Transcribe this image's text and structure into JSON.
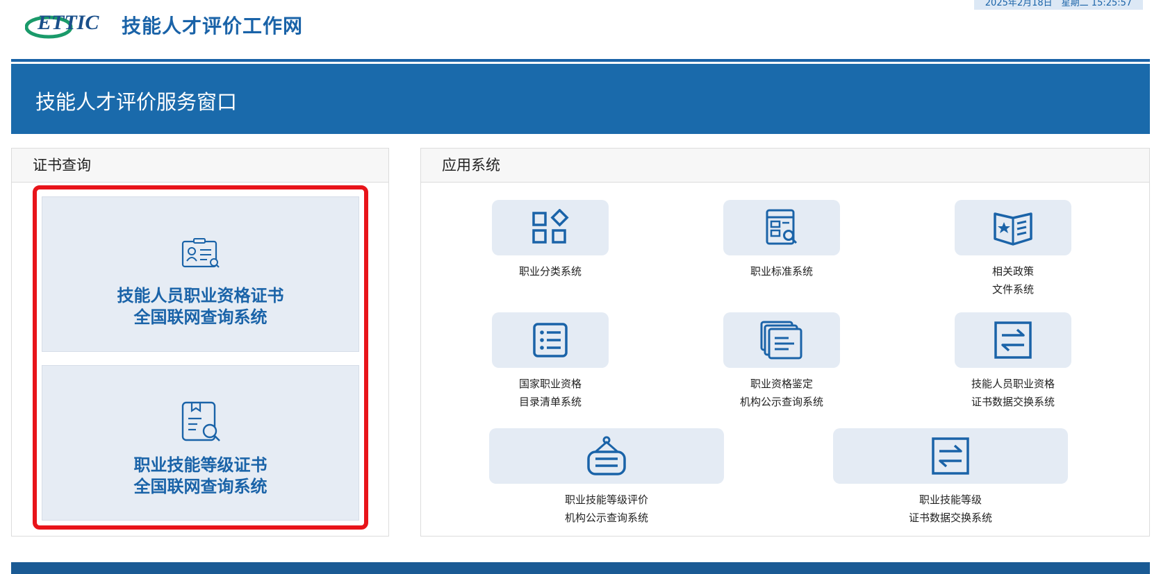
{
  "header": {
    "logo_text": "ETTIC",
    "site_title": "技能人才评价工作网",
    "datetime": "2025年2月18日　星期二 15:25:57"
  },
  "banner": {
    "title": "技能人才评价服务窗口"
  },
  "certificate_query": {
    "title": "证书查询",
    "cards": [
      {
        "line1": "技能人员职业资格证书",
        "line2": "全国联网查询系统",
        "icon": "id-card-search-icon"
      },
      {
        "line1": "职业技能等级证书",
        "line2": "全国联网查询系统",
        "icon": "document-search-icon"
      }
    ]
  },
  "applications": {
    "title": "应用系统",
    "items": [
      {
        "line1": "职业分类系统",
        "line2": "",
        "icon": "category-grid-icon"
      },
      {
        "line1": "职业标准系统",
        "line2": "",
        "icon": "standard-search-icon"
      },
      {
        "line1": "相关政策",
        "line2": "文件系统",
        "icon": "policy-book-icon"
      },
      {
        "line1": "国家职业资格",
        "line2": "目录清单系统",
        "icon": "list-icon"
      },
      {
        "line1": "职业资格鉴定",
        "line2": "机构公示查询系统",
        "icon": "documents-stack-icon"
      },
      {
        "line1": "技能人员职业资格",
        "line2": "证书数据交换系统",
        "icon": "exchange-icon"
      },
      {
        "line1": "职业技能等级评价",
        "line2": "机构公示查询系统",
        "icon": "signboard-icon"
      },
      {
        "line1": "职业技能等级",
        "line2": "证书数据交换系统",
        "icon": "exchange-icon"
      }
    ]
  },
  "colors": {
    "primary": "#1a6aab",
    "highlight": "#e8141a",
    "tile_bg": "#e4ebf4"
  }
}
